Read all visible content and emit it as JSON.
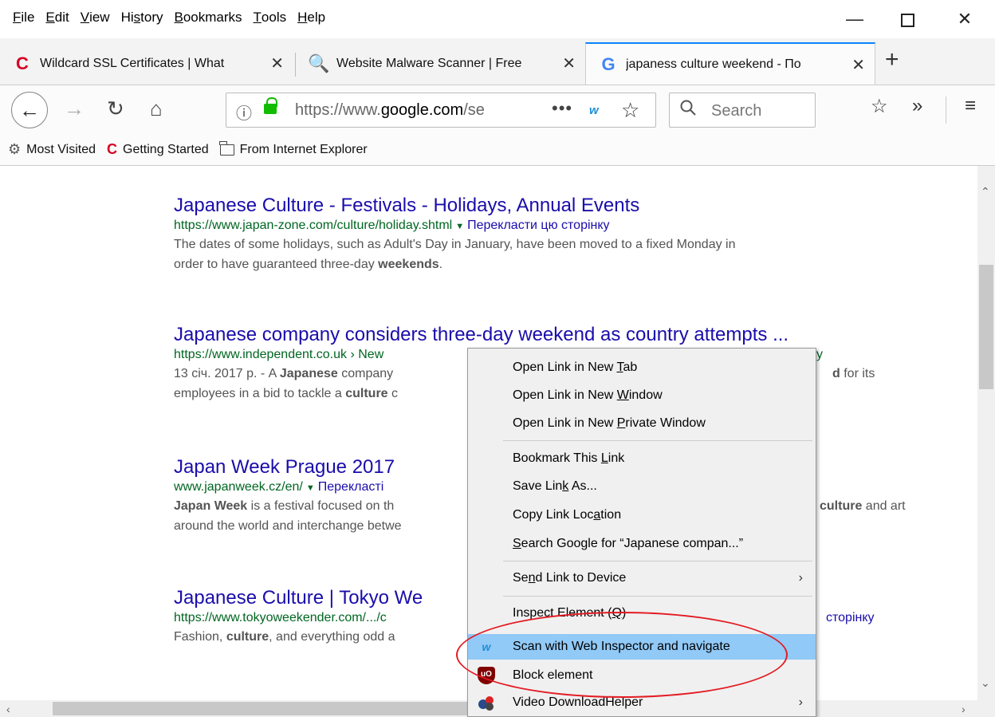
{
  "menubar": {
    "items": [
      {
        "pre": "",
        "acc": "F",
        "post": "ile"
      },
      {
        "pre": "",
        "acc": "E",
        "post": "dit"
      },
      {
        "pre": "",
        "acc": "V",
        "post": "iew"
      },
      {
        "pre": "Hi",
        "acc": "s",
        "post": "tory"
      },
      {
        "pre": "",
        "acc": "B",
        "post": "ookmarks"
      },
      {
        "pre": "",
        "acc": "T",
        "post": "ools"
      },
      {
        "pre": "",
        "acc": "H",
        "post": "elp"
      }
    ],
    "minimize": "—",
    "close": "✕"
  },
  "tabs": [
    {
      "title": "Wildcard SSL Certificates | What",
      "favicon": "C",
      "close": "✕"
    },
    {
      "title": "Website Malware Scanner | Free",
      "favicon": "🔍",
      "close": "✕"
    },
    {
      "title": "japaness culture weekend - По",
      "favicon": "G",
      "close": "✕"
    }
  ],
  "new_tab": "+",
  "nav": {
    "back": "←",
    "forward": "→",
    "reload": "↻",
    "home": "⌂",
    "url_prefix": "https://www.",
    "url_domain": "google.com",
    "url_suffix": "/se",
    "info": "ⓘ",
    "page_actions": "•••",
    "ext_badge": "w",
    "star": "☆",
    "search_icon": "🔍",
    "search_placeholder": "Search",
    "library": "☆",
    "overflow": "»",
    "hamburger": "≡"
  },
  "bookmarks": [
    {
      "label": "Most Visited",
      "icon": "⚙"
    },
    {
      "label": "Getting Started",
      "icon": "C"
    },
    {
      "label": "From Internet Explorer",
      "icon": "folder"
    }
  ],
  "results": [
    {
      "title": "Japanese Culture - Festivals - Holidays, Annual Events",
      "url": "https://www.japan-zone.com/culture/holiday.shtml",
      "translate": "Перекласти цю сторінку",
      "snippet_1": "The dates of some holidays, such as Adult's Day in January, have been moved to a fixed Monday in",
      "snippet_2a": "order to have guaranteed three-day ",
      "snippet_2b": "weekends",
      "snippet_2c": "."
    },
    {
      "title": "Japanese company considers three-day weekend as country attempts ...",
      "url": "https://www.independent.co.uk › New",
      "url_tail": "y",
      "snippet_1a": "13 січ. 2017 р. - A ",
      "snippet_1b": "Japanese",
      "snippet_1c": " company",
      "snippet_1d": "d",
      "snippet_1e": " for its",
      "snippet_2a": "employees in a bid to tackle a ",
      "snippet_2b": "culture",
      "snippet_2c": " c"
    },
    {
      "title": "Japan Week Prague 2017",
      "url": "www.japanweek.cz/en/",
      "translate": "Перекласті",
      "snippet_1a": "Japan Week",
      "snippet_1b": " is a festival focused on th",
      "snippet_1c": "culture",
      "snippet_1d": " and art",
      "snippet_2": "around the world and interchange betwe"
    },
    {
      "title": "Japanese Culture | Tokyo We",
      "url": "https://www.tokyoweekender.com/.../c",
      "translate_tail": "сторінку",
      "snippet_a": "Fashion, ",
      "snippet_b": "culture",
      "snippet_c": ", and everything odd a"
    }
  ],
  "context_menu": {
    "items": [
      {
        "pre": "Open Link in New ",
        "acc": "T",
        "post": "ab"
      },
      {
        "pre": "Open Link in New ",
        "acc": "W",
        "post": "indow"
      },
      {
        "pre": "Open Link in New ",
        "acc": "P",
        "post": "rivate Window"
      },
      {
        "pre": "Bookmark This ",
        "acc": "L",
        "post": "ink"
      },
      {
        "pre": "Save Lin",
        "acc": "k",
        "post": " As..."
      },
      {
        "pre": "Copy Link Loc",
        "acc": "a",
        "post": "tion"
      },
      {
        "pre": "",
        "acc": "S",
        "post": "earch Google for “Japanese compan...”"
      },
      {
        "pre": "Se",
        "acc": "n",
        "post": "d Link to Device"
      },
      {
        "pre": "Inspect Element (",
        "acc": "Q",
        "post": ")"
      },
      {
        "pre": "Scan with Web Inspector and navigate",
        "acc": "",
        "post": ""
      },
      {
        "pre": "Block element",
        "acc": "",
        "post": ""
      },
      {
        "pre": "Video DownloadHelper",
        "acc": "",
        "post": ""
      }
    ],
    "submenu_arrow": "›",
    "ublock_badge": "uO",
    "wi_badge": "w"
  },
  "colors": {
    "link": "#1a0dab",
    "url_green": "#006621",
    "highlight": "#91c9f7",
    "annotation_red": "#e31b23",
    "tab_accent": "#0a84ff"
  }
}
